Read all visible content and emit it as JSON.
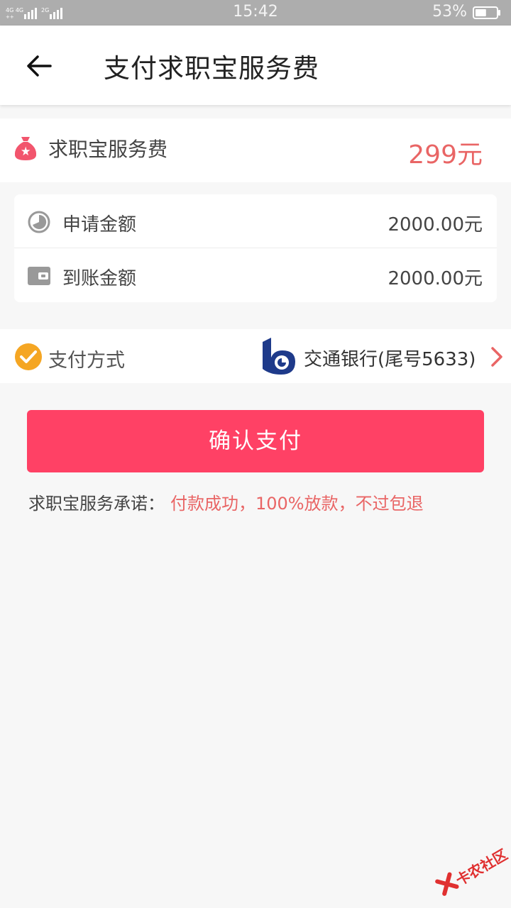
{
  "status_bar": {
    "time": "15:42",
    "battery_percent": "53%",
    "battery_level": 0.53,
    "network": [
      "4G",
      "4G",
      "2G"
    ]
  },
  "header": {
    "title": "支付求职宝服务费"
  },
  "fee": {
    "label": "求职宝服务费",
    "amount": "299元"
  },
  "amounts": {
    "apply_label": "申请金额",
    "apply_value": "2000.00元",
    "received_label": "到账金额",
    "received_value": "2000.00元"
  },
  "payment": {
    "label": "支付方式",
    "bank": "交通银行(尾号5633)"
  },
  "confirm_label": "确认支付",
  "promise": {
    "label": "求职宝服务承诺：",
    "text": "付款成功，100%放款，不过包退"
  },
  "watermark": "卡农社区",
  "colors": {
    "accent": "#ff4165",
    "price": "#e96565",
    "check": "#f5a623",
    "bank_logo": "#1e3a8a"
  }
}
